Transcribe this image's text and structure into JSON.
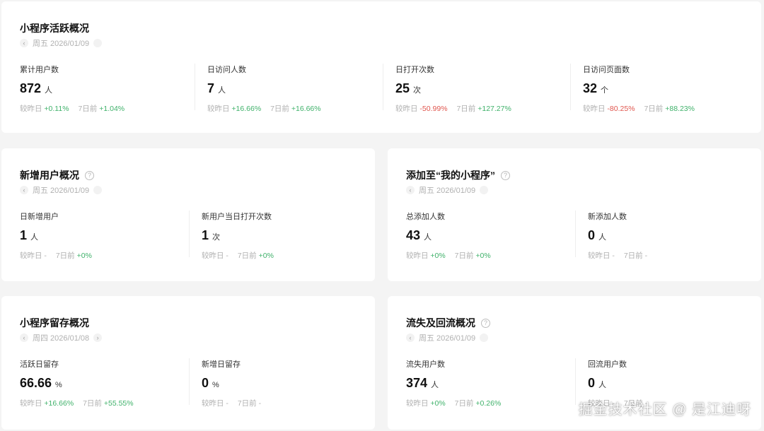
{
  "colors": {
    "up": "#3fb16a",
    "down": "#e0564e",
    "page_background": "#f4f4f4",
    "card_background": "#ffffff"
  },
  "activity": {
    "title": "小程序活跃概况",
    "date": "周五 2026/01/09",
    "metrics": [
      {
        "label": "累计用户数",
        "value": "872",
        "unit": "人",
        "day_label": "较昨日",
        "day_change": "+0.11%",
        "week_label": "7日前",
        "week_change": "+1.04%"
      },
      {
        "label": "日访问人数",
        "value": "7",
        "unit": "人",
        "day_label": "较昨日",
        "day_change": "+16.66%",
        "week_label": "7日前",
        "week_change": "+16.66%"
      },
      {
        "label": "日打开次数",
        "value": "25",
        "unit": "次",
        "day_label": "较昨日",
        "day_change": "-50.99%",
        "week_label": "7日前",
        "week_change": "+127.27%"
      },
      {
        "label": "日访问页面数",
        "value": "32",
        "unit": "个",
        "day_label": "较昨日",
        "day_change": "-80.25%",
        "week_label": "7日前",
        "week_change": "+88.23%"
      }
    ]
  },
  "new_users": {
    "title": "新增用户概况",
    "date": "周五 2026/01/09",
    "metrics": [
      {
        "label": "日新增用户",
        "value": "1",
        "unit": "人",
        "day_label": "较昨日",
        "day_change": "-",
        "week_label": "7日前",
        "week_change": "+0%"
      },
      {
        "label": "新用户当日打开次数",
        "value": "1",
        "unit": "次",
        "day_label": "较昨日",
        "day_change": "-",
        "week_label": "7日前",
        "week_change": "+0%"
      }
    ]
  },
  "add_to_my": {
    "title": "添加至“我的小程序”",
    "date": "周五 2026/01/09",
    "metrics": [
      {
        "label": "总添加人数",
        "value": "43",
        "unit": "人",
        "day_label": "较昨日",
        "day_change": "+0%",
        "week_label": "7日前",
        "week_change": "+0%"
      },
      {
        "label": "新添加人数",
        "value": "0",
        "unit": "人",
        "day_label": "较昨日",
        "day_change": "-",
        "week_label": "7日前",
        "week_change": "-"
      }
    ]
  },
  "retention": {
    "title": "小程序留存概况",
    "date": "周四 2026/01/08",
    "metrics": [
      {
        "label": "活跃日留存",
        "value": "66.66",
        "unit": "%",
        "day_label": "较昨日",
        "day_change": "+16.66%",
        "week_label": "7日前",
        "week_change": "+55.55%"
      },
      {
        "label": "新增日留存",
        "value": "0",
        "unit": "%",
        "day_label": "较昨日",
        "day_change": "-",
        "week_label": "7日前",
        "week_change": "-"
      }
    ]
  },
  "churn": {
    "title": "流失及回流概况",
    "date": "周五 2026/01/09",
    "metrics": [
      {
        "label": "流失用户数",
        "value": "374",
        "unit": "人",
        "day_label": "较昨日",
        "day_change": "+0%",
        "week_label": "7日前",
        "week_change": "+0.26%"
      },
      {
        "label": "回流用户数",
        "value": "0",
        "unit": "人",
        "day_label": "较昨日",
        "day_change": "-",
        "week_label": "7日前",
        "week_change": "-"
      }
    ]
  },
  "watermark": "掘金技术社区 @ 是江迪呀"
}
